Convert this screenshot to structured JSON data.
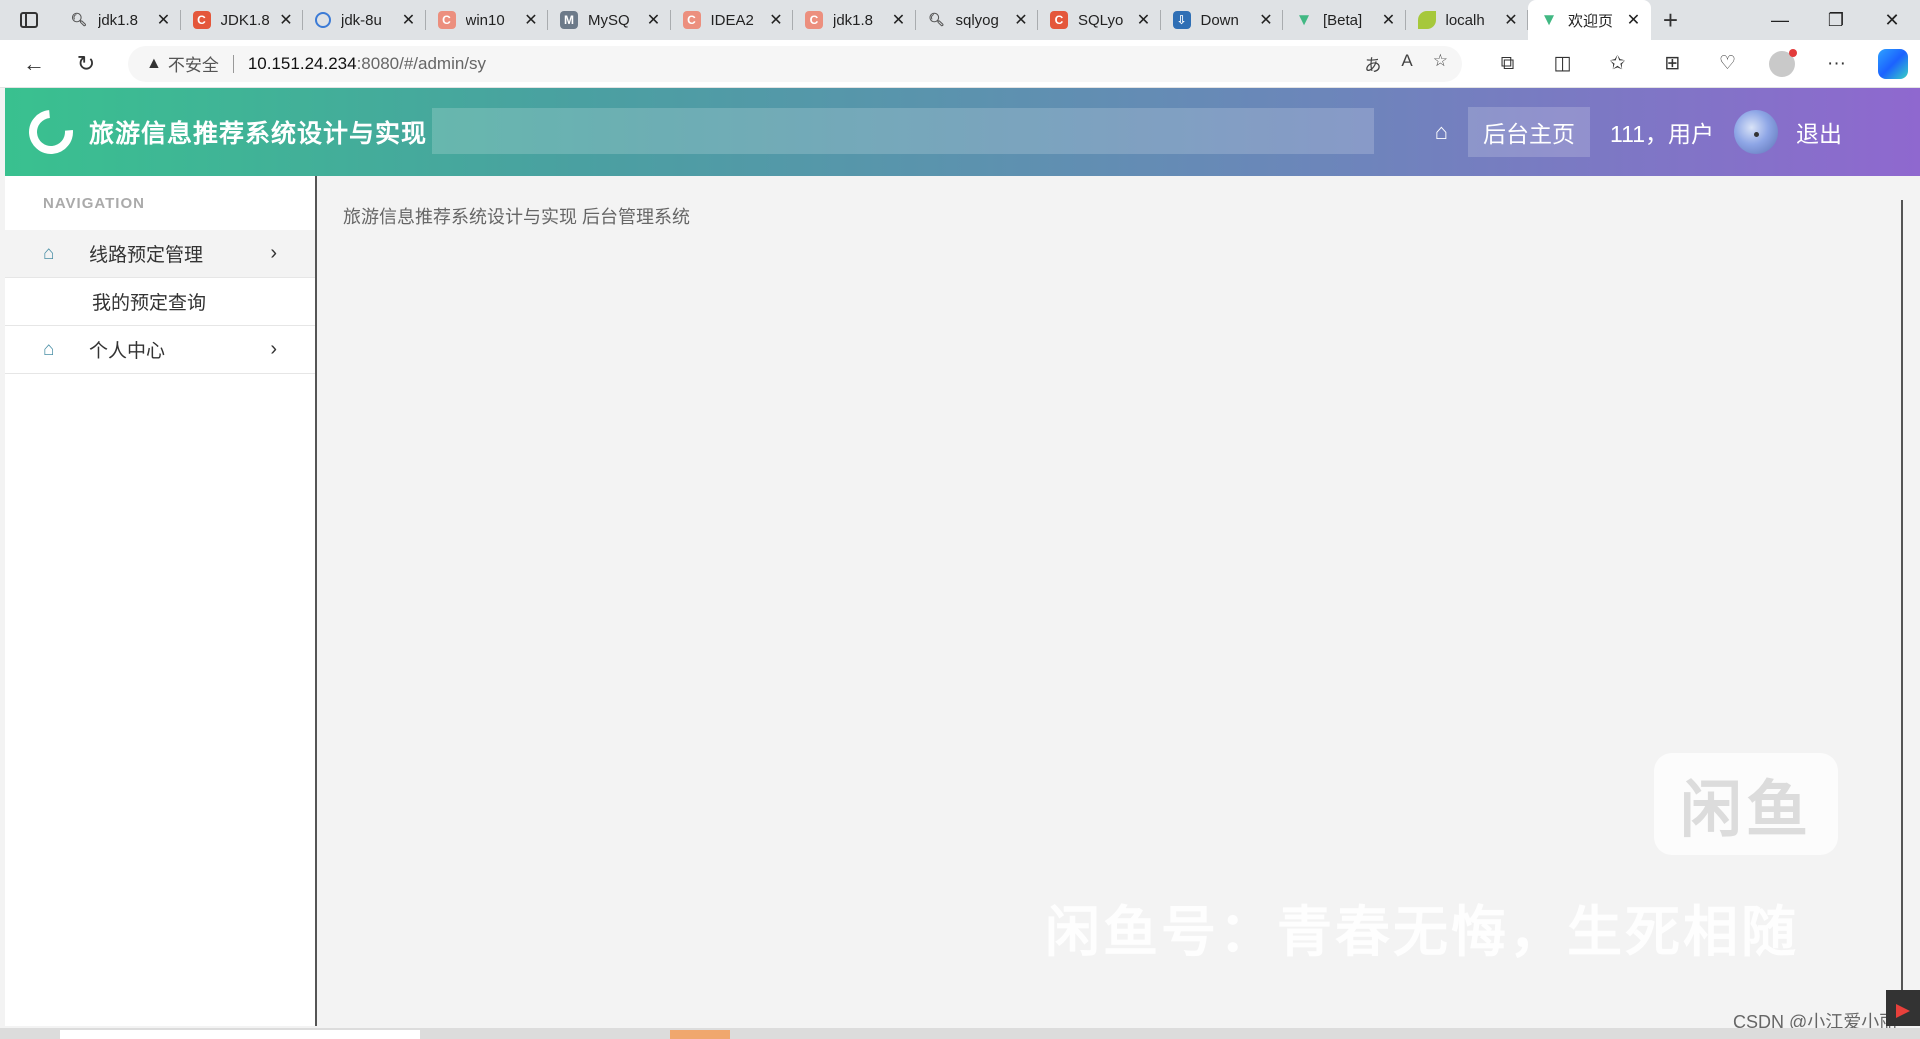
{
  "browser": {
    "tabs": [
      {
        "title": "jdk1.8",
        "icon": "search-icon"
      },
      {
        "title": "JDK1.8",
        "icon": "csdn-icon"
      },
      {
        "title": "jdk-8u",
        "icon": "gear-icon"
      },
      {
        "title": "win10",
        "icon": "csdn-icon"
      },
      {
        "title": "MySQ",
        "icon": "mysql-icon"
      },
      {
        "title": "IDEA2",
        "icon": "csdn-icon"
      },
      {
        "title": "jdk1.8",
        "icon": "csdn-icon"
      },
      {
        "title": "sqlyog",
        "icon": "search-icon"
      },
      {
        "title": "SQLyo",
        "icon": "csdn-icon"
      },
      {
        "title": "Down",
        "icon": "download-site-icon"
      },
      {
        "title": "[Beta]",
        "icon": "vue-icon"
      },
      {
        "title": "localh",
        "icon": "leaf-icon"
      },
      {
        "title": "欢迎页",
        "icon": "vue-icon",
        "active": true
      }
    ],
    "address": {
      "security_label": "不安全",
      "host": "10.151.24.234",
      "path": ":8080/#/admin/sy"
    }
  },
  "header": {
    "title": "旅游信息推荐系统设计与实现",
    "home_label": "后台主页",
    "user_label": "111，用户",
    "logout_label": "退出"
  },
  "sidebar": {
    "caption": "NAVIGATION",
    "items": [
      {
        "label": "线路预定管理",
        "expanded": true,
        "children": [
          {
            "label": "我的预定查询"
          }
        ]
      },
      {
        "label": "个人中心",
        "expanded": false
      }
    ]
  },
  "main": {
    "welcome": "旅游信息推荐系统设计与实现 后台管理系统"
  },
  "watermark": {
    "logo_text": "闲鱼",
    "text": "闲鱼号：青春无悔，生死相随",
    "csdn": "CSDN @小江爱小丽"
  },
  "colors": {
    "header_start": "#39c18f",
    "header_end": "#8f68cf",
    "menu_icon": "#4a8fa6"
  }
}
